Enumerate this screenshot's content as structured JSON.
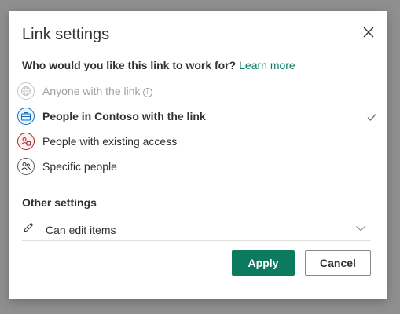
{
  "dialog": {
    "title": "Link settings",
    "close_icon": "close-icon"
  },
  "audience": {
    "question": "Who would you like this link to work for?",
    "learn_more": "Learn more",
    "options": [
      {
        "label": "Anyone with the link",
        "icon": "globe-icon",
        "state": "disabled",
        "info_icon": "info-icon"
      },
      {
        "label": "People in Contoso with the link",
        "icon": "briefcase-icon",
        "state": "selected"
      },
      {
        "label": "People with existing access",
        "icon": "people-existing-icon",
        "state": "normal"
      },
      {
        "label": "Specific people",
        "icon": "specific-people-icon",
        "state": "normal"
      }
    ],
    "selected_check_icon": "checkmark-icon"
  },
  "other_settings": {
    "title": "Other settings",
    "permission_label": "Can edit items",
    "permission_icon": "pencil-icon",
    "dropdown_icon": "chevron-down-icon"
  },
  "buttons": {
    "apply": "Apply",
    "cancel": "Cancel"
  },
  "colors": {
    "accent": "#0b7a5e",
    "selected_icon": "#0f6cbd",
    "existing_icon": "#a4262c",
    "disabled_text": "#a19f9d"
  }
}
